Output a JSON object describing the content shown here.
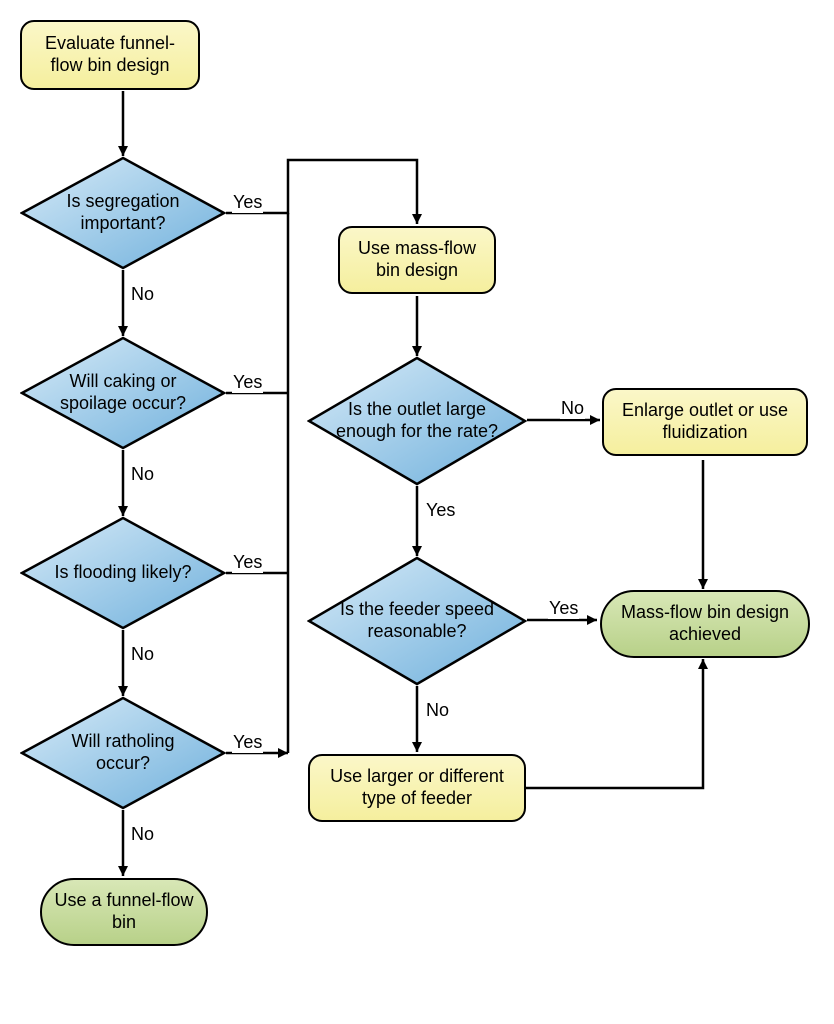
{
  "nodes": {
    "start": "Evaluate funnel-flow bin design",
    "q_segregation": "Is segregation important?",
    "q_caking": "Will caking or spoilage occur?",
    "q_flooding": "Is flooding likely?",
    "q_ratholing": "Will ratholing occur?",
    "use_funnel": "Use a funnel-flow bin",
    "use_massflow": "Use mass-flow bin design",
    "q_outlet": "Is the outlet large enough for the rate?",
    "enlarge_outlet": "Enlarge outlet or use fluidization",
    "q_feeder": "Is the feeder speed reasonable?",
    "use_larger_feeder": "Use larger or different type of feeder",
    "achieved": "Mass-flow bin design achieved"
  },
  "labels": {
    "yes": "Yes",
    "no": "No"
  },
  "chart_data": {
    "type": "flowchart",
    "nodes": [
      {
        "id": "start",
        "kind": "process",
        "text": "Evaluate funnel-flow bin design"
      },
      {
        "id": "q_segregation",
        "kind": "decision",
        "text": "Is segregation important?"
      },
      {
        "id": "q_caking",
        "kind": "decision",
        "text": "Will caking or spoilage occur?"
      },
      {
        "id": "q_flooding",
        "kind": "decision",
        "text": "Is flooding likely?"
      },
      {
        "id": "q_ratholing",
        "kind": "decision",
        "text": "Will ratholing occur?"
      },
      {
        "id": "use_funnel",
        "kind": "terminator",
        "text": "Use a funnel-flow bin"
      },
      {
        "id": "use_massflow",
        "kind": "process",
        "text": "Use mass-flow bin design"
      },
      {
        "id": "q_outlet",
        "kind": "decision",
        "text": "Is the outlet large enough for the rate?"
      },
      {
        "id": "enlarge_outlet",
        "kind": "process",
        "text": "Enlarge outlet or use fluidization"
      },
      {
        "id": "q_feeder",
        "kind": "decision",
        "text": "Is the feeder speed reasonable?"
      },
      {
        "id": "use_larger_feeder",
        "kind": "process",
        "text": "Use larger or different type of feeder"
      },
      {
        "id": "achieved",
        "kind": "terminator",
        "text": "Mass-flow bin design achieved"
      }
    ],
    "edges": [
      {
        "from": "start",
        "to": "q_segregation"
      },
      {
        "from": "q_segregation",
        "to": "use_massflow",
        "label": "Yes"
      },
      {
        "from": "q_segregation",
        "to": "q_caking",
        "label": "No"
      },
      {
        "from": "q_caking",
        "to": "use_massflow",
        "label": "Yes"
      },
      {
        "from": "q_caking",
        "to": "q_flooding",
        "label": "No"
      },
      {
        "from": "q_flooding",
        "to": "use_massflow",
        "label": "Yes"
      },
      {
        "from": "q_flooding",
        "to": "q_ratholing",
        "label": "No"
      },
      {
        "from": "q_ratholing",
        "to": "use_massflow",
        "label": "Yes"
      },
      {
        "from": "q_ratholing",
        "to": "use_funnel",
        "label": "No"
      },
      {
        "from": "use_massflow",
        "to": "q_outlet"
      },
      {
        "from": "q_outlet",
        "to": "enlarge_outlet",
        "label": "No"
      },
      {
        "from": "q_outlet",
        "to": "q_feeder",
        "label": "Yes"
      },
      {
        "from": "enlarge_outlet",
        "to": "achieved"
      },
      {
        "from": "q_feeder",
        "to": "achieved",
        "label": "Yes"
      },
      {
        "from": "q_feeder",
        "to": "use_larger_feeder",
        "label": "No"
      },
      {
        "from": "use_larger_feeder",
        "to": "achieved"
      }
    ]
  },
  "colors": {
    "process_fill_top": "#fbf7c8",
    "process_fill_bottom": "#f5ef9e",
    "terminator_fill_top": "#d8e7b6",
    "terminator_fill_bottom": "#b8d189",
    "decision_fill_top": "#cfe4f5",
    "decision_fill_bottom": "#7cb6de",
    "stroke": "#000000"
  }
}
